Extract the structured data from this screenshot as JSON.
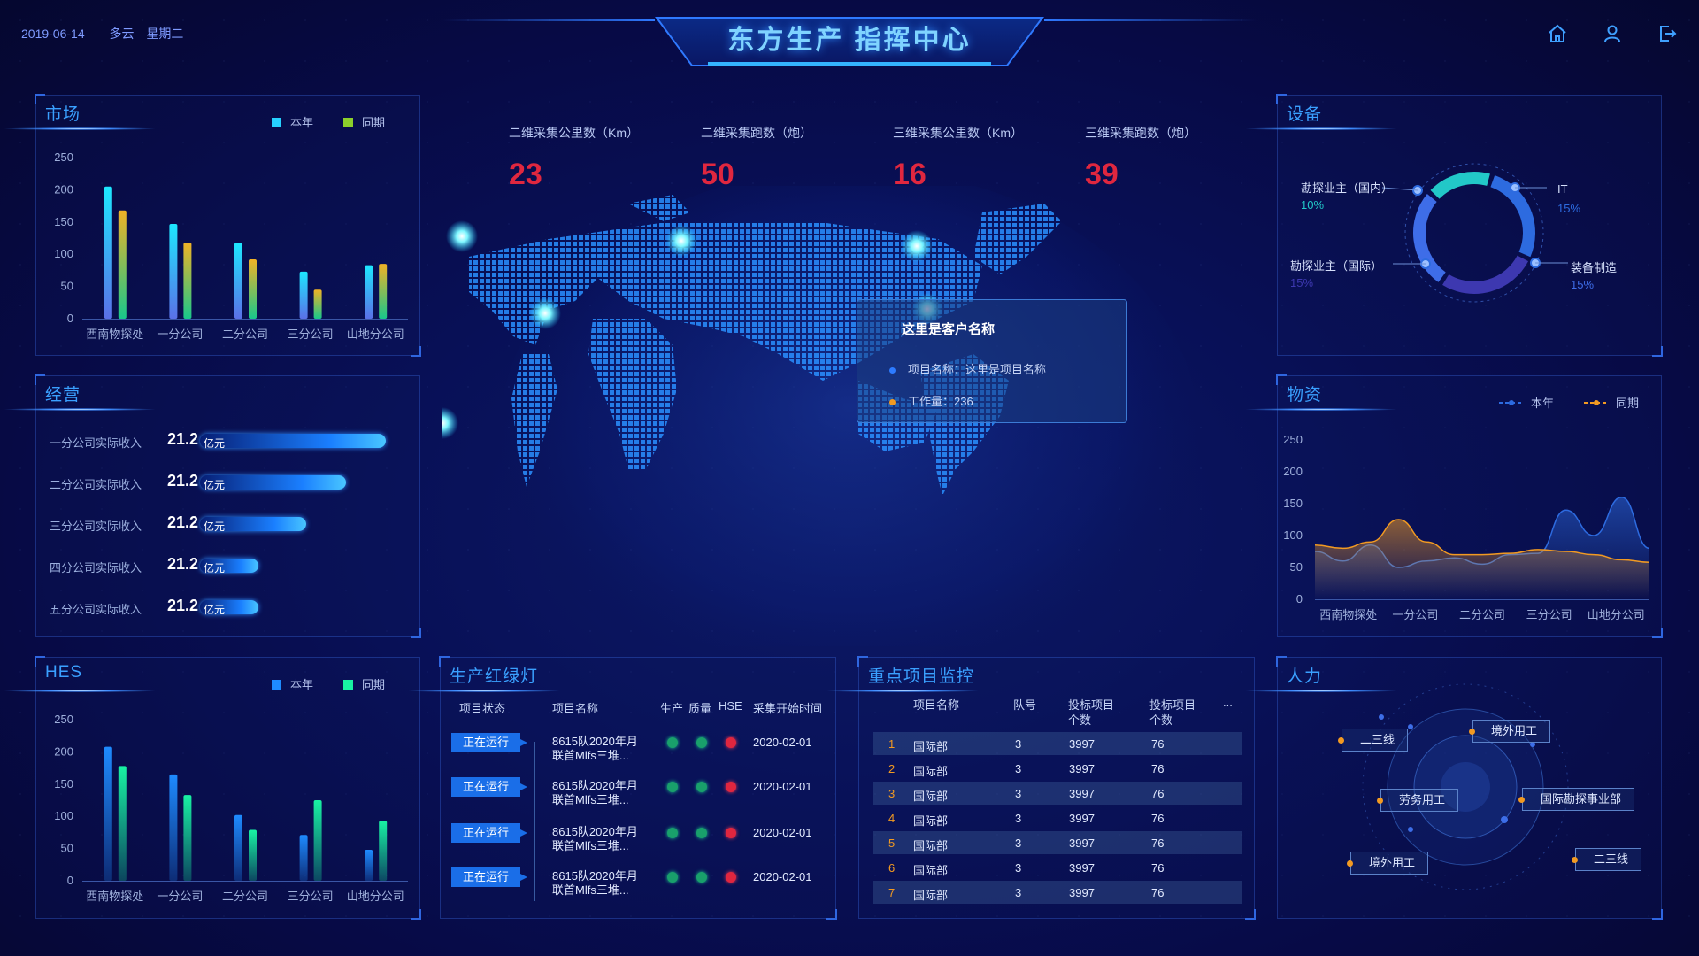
{
  "header": {
    "date": "2019-06-14",
    "weather": "多云",
    "weekday": "星期二",
    "title": "东方生产 指挥中心",
    "icons": [
      "home-icon",
      "user-icon",
      "logout-icon"
    ]
  },
  "colors": {
    "this_year": "#26d1ff",
    "last_year": "#8ccf2b",
    "hes_this": "#1e8bff",
    "hes_last": "#19f2a3",
    "accent": "#3aa0ff",
    "stat_value": "#e0273f"
  },
  "stats": [
    {
      "label": "二维采集公里数（Km）",
      "value": "23"
    },
    {
      "label": "二维采集跑数（炮）",
      "value": "50"
    },
    {
      "label": "三维采集公里数（Km）",
      "value": "16"
    },
    {
      "label": "三维采集跑数（炮）",
      "value": "39"
    }
  ],
  "market": {
    "title": "市场",
    "legend": [
      "本年",
      "同期"
    ],
    "y_ticks": [
      "250",
      "200",
      "150",
      "100",
      "50",
      "0"
    ]
  },
  "operations": {
    "title": "经营",
    "rows": [
      {
        "label": "一分公司实际收入",
        "value": "21.2",
        "unit": "亿元",
        "level": 1.0
      },
      {
        "label": "二分公司实际收入",
        "value": "21.2",
        "unit": "亿元",
        "level": 0.75
      },
      {
        "label": "三分公司实际收入",
        "value": "21.2",
        "unit": "亿元",
        "level": 0.5
      },
      {
        "label": "四分公司实际收入",
        "value": "21.2",
        "unit": "亿元",
        "level": 0.2
      },
      {
        "label": "五分公司实际收入",
        "value": "21.2",
        "unit": "亿元",
        "level": 0.2
      }
    ]
  },
  "hes": {
    "title": "HES",
    "legend": [
      "本年",
      "同期"
    ]
  },
  "equipment": {
    "title": "设备",
    "labels": [
      {
        "name": "勘探业主（国内）",
        "pct": "10%"
      },
      {
        "name": "IT",
        "pct": "15%"
      },
      {
        "name": "勘探业主（国际）",
        "pct": "15%"
      },
      {
        "name": "装备制造",
        "pct": "15%"
      }
    ]
  },
  "materials": {
    "title": "物资",
    "legend": [
      "本年",
      "同期"
    ]
  },
  "tooltip": {
    "customer": "这里是客户名称",
    "project_label": "项目名称：这里是项目名称",
    "workload_label": "工作量：236"
  },
  "traffic": {
    "title": "生产红绿灯",
    "headers": [
      "项目状态",
      "项目名称",
      "生产",
      "质量",
      "HSE",
      "采集开始时间"
    ],
    "rows": [
      {
        "status": "正在运行",
        "name1": "8615队2020年月",
        "name2": "联首Mlfs三堆...",
        "date": "2020-02-01"
      },
      {
        "status": "正在运行",
        "name1": "8615队2020年月",
        "name2": "联首Mlfs三堆...",
        "date": "2020-02-01"
      },
      {
        "status": "正在运行",
        "name1": "8615队2020年月",
        "name2": "联首Mlfs三堆...",
        "date": "2020-02-01"
      },
      {
        "status": "正在运行",
        "name1": "8615队2020年月",
        "name2": "联首Mlfs三堆...",
        "date": "2020-02-01"
      }
    ]
  },
  "projects": {
    "title": "重点项目监控",
    "headers": [
      "项目名称",
      "队号",
      "投标项目",
      "个数",
      "投标项目",
      "个数",
      "..."
    ],
    "rows": [
      {
        "no": "1",
        "name": "国际部",
        "team": "3",
        "a": "3997",
        "b": "76"
      },
      {
        "no": "2",
        "name": "国际部",
        "team": "3",
        "a": "3997",
        "b": "76"
      },
      {
        "no": "3",
        "name": "国际部",
        "team": "3",
        "a": "3997",
        "b": "76"
      },
      {
        "no": "4",
        "name": "国际部",
        "team": "3",
        "a": "3997",
        "b": "76"
      },
      {
        "no": "5",
        "name": "国际部",
        "team": "3",
        "a": "3997",
        "b": "76"
      },
      {
        "no": "6",
        "name": "国际部",
        "team": "3",
        "a": "3997",
        "b": "76"
      },
      {
        "no": "7",
        "name": "国际部",
        "team": "3",
        "a": "3997",
        "b": "76"
      }
    ]
  },
  "manpower": {
    "title": "人力",
    "tags": [
      "二三线",
      "境外用工",
      "劳务用工",
      "国际勘探事业部",
      "境外用工",
      "二三线"
    ]
  },
  "chart_data": [
    {
      "type": "bar",
      "categories": [
        "西南物探处",
        "一分公司",
        "二分公司",
        "三分公司",
        "山地分公司"
      ],
      "series": [
        {
          "name": "本年",
          "values": [
            205,
            147,
            118,
            73,
            83
          ]
        },
        {
          "name": "同期",
          "values": [
            168,
            118,
            92,
            45,
            85
          ]
        }
      ],
      "ylim": [
        0,
        250
      ]
    },
    {
      "type": "bar",
      "categories": [
        "西南物探处",
        "一分公司",
        "二分公司",
        "三分公司",
        "山地分公司"
      ],
      "series": [
        {
          "name": "本年",
          "values": [
            208,
            165,
            102,
            71,
            48
          ]
        },
        {
          "name": "同期",
          "values": [
            178,
            133,
            79,
            125,
            93
          ]
        }
      ],
      "ylim": [
        0,
        250
      ]
    },
    {
      "type": "area",
      "categories": [
        "西南物探处",
        "一分公司",
        "二分公司",
        "三分公司",
        "山地分公司"
      ],
      "series": [
        {
          "name": "本年",
          "values": [
            75,
            60,
            85,
            50,
            60,
            65,
            55,
            70,
            72,
            140,
            100,
            160,
            80
          ]
        },
        {
          "name": "同期",
          "values": [
            85,
            80,
            90,
            125,
            90,
            70,
            70,
            72,
            78,
            75,
            70,
            62,
            58
          ]
        }
      ],
      "y_ticks": [
        "250",
        "200",
        "150",
        "100",
        "50",
        "0"
      ],
      "ylim": [
        0,
        250
      ]
    },
    {
      "type": "pie",
      "categories": [
        "勘探业主（国内）",
        "IT",
        "勘探业主（国际）",
        "装备制造"
      ],
      "values": [
        10,
        15,
        15,
        15
      ]
    }
  ]
}
